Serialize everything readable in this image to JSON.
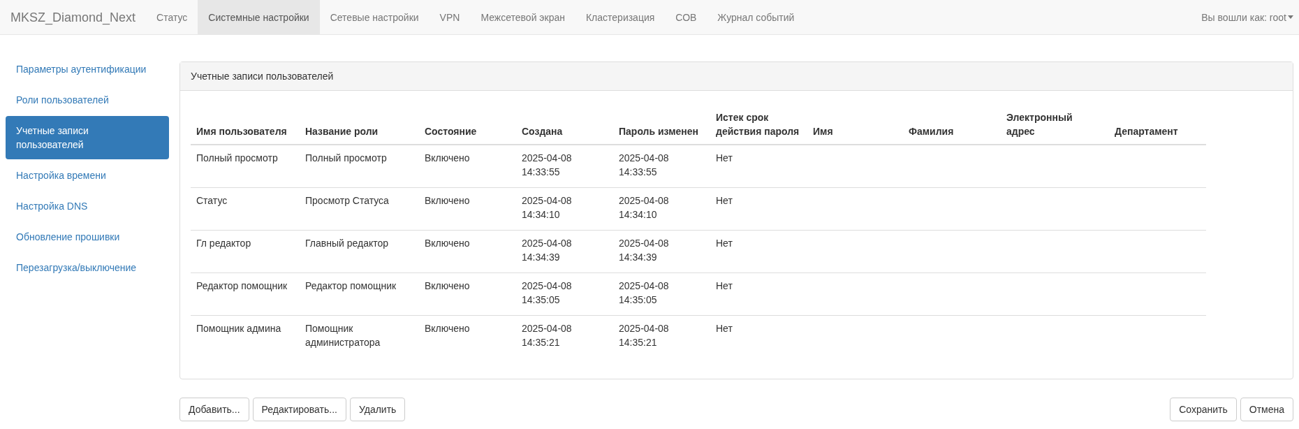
{
  "navbar": {
    "brand": "MKSZ_Diamond_Next",
    "items": [
      {
        "label": "Статус",
        "selected": false
      },
      {
        "label": "Системные настройки",
        "selected": true
      },
      {
        "label": "Сетевые настройки",
        "selected": false
      },
      {
        "label": "VPN",
        "selected": false
      },
      {
        "label": "Межсетевой экран",
        "selected": false
      },
      {
        "label": "Кластеризация",
        "selected": false
      },
      {
        "label": "СОВ",
        "selected": false
      },
      {
        "label": "Журнал событий",
        "selected": false
      }
    ],
    "user_menu": "Вы вошли как: root"
  },
  "sidebar": {
    "items": [
      {
        "label": "Параметры аутентификации",
        "selected": false
      },
      {
        "label": "Роли пользователей",
        "selected": false
      },
      {
        "label": "Учетные записи пользователей",
        "selected": true
      },
      {
        "label": "Настройка времени",
        "selected": false
      },
      {
        "label": "Настройка DNS",
        "selected": false
      },
      {
        "label": "Обновление прошивки",
        "selected": false
      },
      {
        "label": "Перезагрузка/выключение",
        "selected": false
      }
    ]
  },
  "panel": {
    "title": "Учетные записи пользователей",
    "table": {
      "columns": [
        "Имя пользователя",
        "Название роли",
        "Состояние",
        "Создана",
        "Пароль изменен",
        "Истек срок действия пароля",
        "Имя",
        "Фамилия",
        "Электронный адрес",
        "Департамент"
      ],
      "rows": [
        [
          "Полный просмотр",
          "Полный просмотр",
          "Включено",
          "2025-04-08\n14:33:55",
          "2025-04-08\n14:33:55",
          "Нет"
        ],
        [
          "Статус",
          "Просмотр Статуса",
          "Включено",
          "2025-04-08\n14:34:10",
          "2025-04-08\n14:34:10",
          "Нет"
        ],
        [
          "Гл редактор",
          "Главный редактор",
          "Включено",
          "2025-04-08\n14:34:39",
          "2025-04-08\n14:34:39",
          "Нет"
        ],
        [
          "Редактор помощник",
          "Редактор помощник",
          "Включено",
          "2025-04-08\n14:35:05",
          "2025-04-08\n14:35:05",
          "Нет"
        ],
        [
          "Помощник админа",
          "Помощник администратора",
          "Включено",
          "2025-04-08\n14:35:21",
          "2025-04-08\n14:35:21",
          "Нет"
        ]
      ]
    }
  },
  "actions_left": [
    "Добавить...",
    "Редактировать...",
    "Удалить"
  ],
  "actions_right": [
    "Сохранить",
    "Отмена"
  ]
}
